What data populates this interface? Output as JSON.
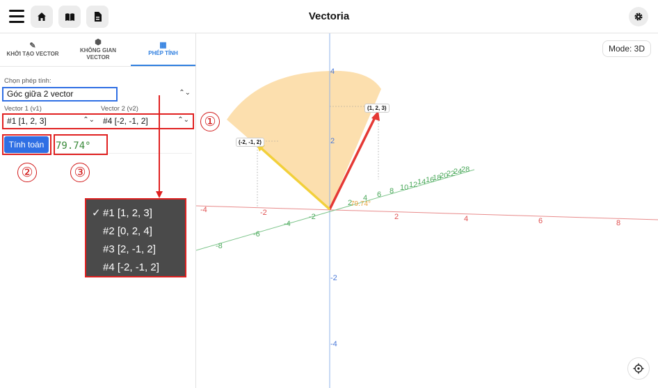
{
  "header": {
    "title": "Vectoria"
  },
  "tabs": [
    {
      "label": "KHỞI TẠO VECTOR",
      "icon": "pencil-icon"
    },
    {
      "label": "KHÔNG GIAN VECTOR",
      "icon": "cube-icon"
    },
    {
      "label": "PHÉP TÍNH",
      "icon": "calculator-icon",
      "active": true
    }
  ],
  "form": {
    "operation_label": "Chọn phép tính:",
    "operation_value": "Góc giữa 2 vector",
    "v1_label": "Vector 1 (v1)",
    "v2_label": "Vector 2 (v2)",
    "v1_value": "#1 [1, 2, 3]",
    "v2_value": "#4 [-2, -1, 2]",
    "calc_button": "Tính toán",
    "result": "79.74°"
  },
  "annotations": {
    "one": "①",
    "two": "②",
    "three": "③"
  },
  "dropdown": {
    "check": "✓",
    "options": [
      "#1 [1, 2, 3]",
      "#2 [0, 2, 4]",
      "#3 [2, -1, 2]",
      "#4 [-2, -1, 2]"
    ]
  },
  "scene": {
    "mode": "Mode: 3D",
    "vector_labels": {
      "v1": "(1, 2, 3)",
      "v2": "(-2, -1, 2)"
    },
    "angle_label": "79.74°",
    "x_ticks": [
      "-4",
      "-2",
      "2",
      "4",
      "6",
      "8"
    ],
    "y_ticks": [
      "4",
      "2",
      "-2",
      "-4"
    ],
    "z_ticks": [
      "-8",
      "-6",
      "-4",
      "-2",
      "2",
      "4",
      "6",
      "8",
      "10",
      "12",
      "14",
      "16",
      "18",
      "20",
      "22",
      "24",
      "28"
    ],
    "colors": {
      "v1": "#e53935",
      "v2": "#f2d03b",
      "angle_fill": "#fcd9a0",
      "x_axis": "#e88a8a",
      "y_axis": "#8fb3e8",
      "z_axis": "#7cc48a"
    }
  }
}
